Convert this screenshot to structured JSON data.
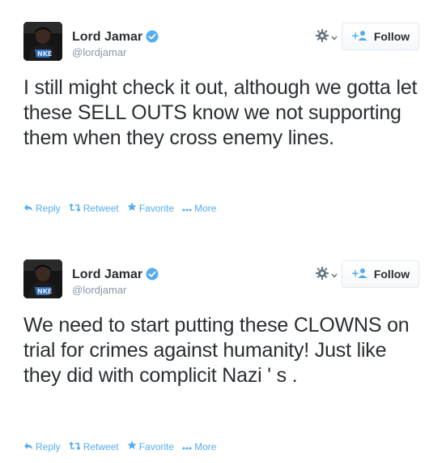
{
  "tweets": [
    {
      "author_name": "Lord Jamar",
      "handle": "@lordjamar",
      "follow_label": "Follow",
      "text": "I still might check it out, although we gotta let these SELL OUTS know we not supporting them when they cross enemy lines.",
      "actions": {
        "reply": "Reply",
        "retweet": "Retweet",
        "favorite": "Favorite",
        "more": "More"
      }
    },
    {
      "author_name": "Lord Jamar",
      "handle": "@lordjamar",
      "follow_label": "Follow",
      "text": "We need to start putting these CLOWNS on trial for crimes against humanity! Just like they did with complicit Nazi ' s .",
      "actions": {
        "reply": "Reply",
        "retweet": "Retweet",
        "favorite": "Favorite",
        "more": "More"
      }
    }
  ],
  "icons": {
    "verified": "verified-badge-icon",
    "settings": "gear-icon",
    "follow": "add-user-icon",
    "reply": "reply-icon",
    "retweet": "retweet-icon",
    "favorite": "star-icon",
    "more": "ellipsis-icon"
  },
  "colors": {
    "accent": "#55acee",
    "text": "#292f33",
    "muted": "#8899a6"
  }
}
